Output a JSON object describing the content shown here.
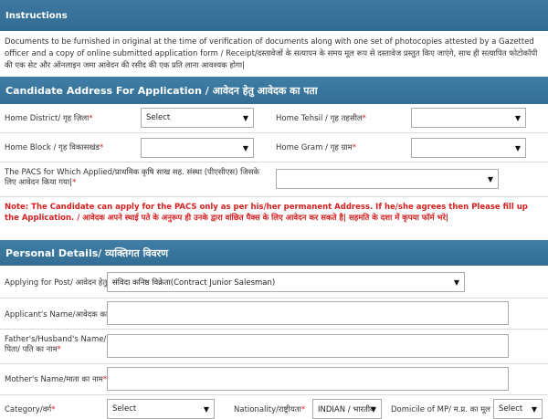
{
  "instructions": {
    "title": "Instructions",
    "text": "Documents to be furnished in original at the time of verification of documents along with one set of photocopies attested by a Gazetted officer and a copy of online submitted application form / Receipt/दस्तावेजों के सत्यापन के समय मूल रूप से दस्तावेज प्रस्तुत किए जाएंगे, साथ ही सत्यापित फोटोकॉपी की एक सेट और ऑनलाइन जमा आवेदन की रसीद की एक प्रति लाना आवश्यक होगा|"
  },
  "address_section": {
    "title": "Candidate Address For Application / आवेदन हेतु आवेदक का पता",
    "home_district": {
      "label": "Home District/ गृह ज़िला",
      "value": "Select"
    },
    "home_tehsil": {
      "label": "Home Tehsil / गृह तहसील",
      "value": ""
    },
    "home_block": {
      "label": "Home Block / गृह विकासखंड",
      "value": ""
    },
    "home_gram": {
      "label": "Home Gram / गृह ग्राम",
      "value": ""
    },
    "pacs": {
      "label": "The PACS for Which Applied/प्राथमिक कृषि साख सह. संस्था (पीएसीएस) जिसके लिए आवेदन किया गया|",
      "value": ""
    },
    "note": "Note:  The Candidate can apply for the PACS only as per his/her permanent Address. If he/she agrees then Please fill up the Application. / आवेदक अपने स्थाई पते के अनुरूप ही उनके द्वारा वांछित पैक्स के लिए आवेदन कर सकते है| सहमति के दशा में कृपया फॉर्म भरे|"
  },
  "personal_section": {
    "title": "Personal Details/ व्यक्तिगत विवरण",
    "post": {
      "label": "Applying for Post/ आवेदन हेतु पद",
      "value": "संविदा कनिष्ठ विक्रेता(Contract Junior Salesman)"
    },
    "name": {
      "label": "Applicant's Name/आवेदक का नाम",
      "value": ""
    },
    "father": {
      "label": "Father's/Husband's Name/पिता/ पति का नाम",
      "value": ""
    },
    "mother": {
      "label": "Mother's Name/माता का नाम",
      "value": ""
    },
    "category": {
      "label": "Category/वर्ग",
      "value": "Select"
    },
    "nationality": {
      "label": "Nationality/राष्ट्रीयता",
      "value": "INDIAN / भारतीय"
    },
    "domicile": {
      "label": "Domicile of MP/ म.प्र. का मूल निवासी",
      "value": "Select"
    }
  },
  "required_mark": "*",
  "arrow": "▼"
}
